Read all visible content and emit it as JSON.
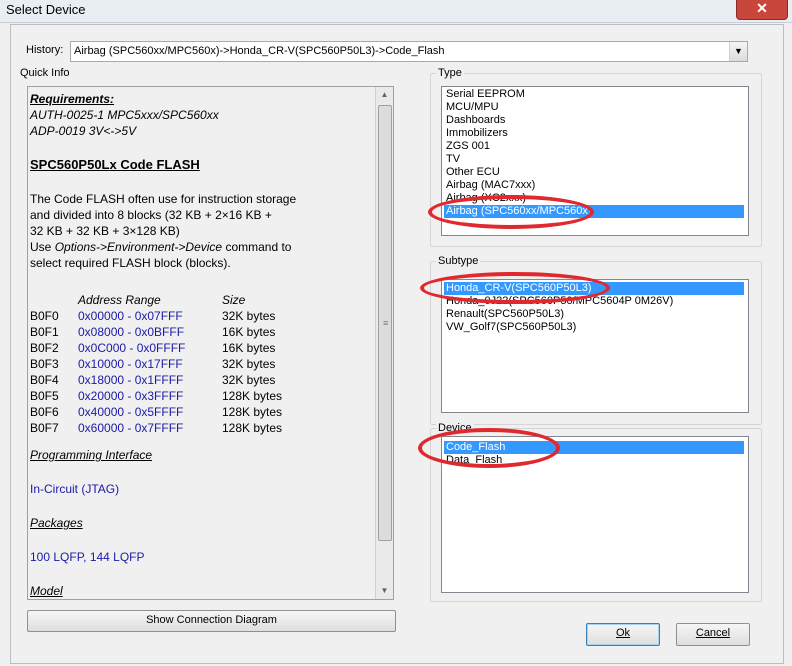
{
  "window": {
    "title": "Select Device",
    "close_glyph": "✕"
  },
  "history": {
    "label": "History:",
    "value": "Airbag (SPC560xx/MPC560x)->Honda_CR-V(SPC560P50L3)->Code_Flash",
    "arrow_glyph": "▼"
  },
  "quick_info": {
    "label": "Quick Info",
    "requirements_heading": "Requirements:",
    "requirement_1": "AUTH-0025-1 MPC5xxx/SPC560xx",
    "requirement_2": "ADP-0019 3V<->5V",
    "device_title": "SPC560P50Lx Code FLASH",
    "desc_line_1": "The Code FLASH often use for instruction storage",
    "desc_line_2": "and divided into 8 blocks (32 KB + 2×16 KB +",
    "desc_line_3": "32 KB + 32 KB + 3×128 KB)",
    "desc_line_4_prefix": "Use ",
    "desc_line_4_italic": "Options->Environment->Device",
    "desc_line_4_suffix": " command to",
    "desc_line_5": "select required FLASH block (blocks).",
    "table_header_range": "Address Range",
    "table_header_size": "Size",
    "blocks": [
      {
        "name": "B0F0",
        "range": "0x00000 - 0x07FFF",
        "size": "32K bytes"
      },
      {
        "name": "B0F1",
        "range": "0x08000 - 0x0BFFF",
        "size": "16K bytes"
      },
      {
        "name": "B0F2",
        "range": "0x0C000 - 0x0FFFF",
        "size": "16K bytes"
      },
      {
        "name": "B0F3",
        "range": "0x10000 - 0x17FFF",
        "size": "32K bytes"
      },
      {
        "name": "B0F4",
        "range": "0x18000 - 0x1FFFF",
        "size": "32K bytes"
      },
      {
        "name": "B0F5",
        "range": "0x20000 - 0x3FFFF",
        "size": "128K bytes"
      },
      {
        "name": "B0F6",
        "range": "0x40000 - 0x5FFFF",
        "size": "128K bytes"
      },
      {
        "name": "B0F7",
        "range": "0x60000 - 0x7FFFF",
        "size": "128K bytes"
      }
    ],
    "programming_interface_heading": "Programming Interface",
    "programming_interface_value": "In-Circuit (JTAG)",
    "packages_heading": "Packages",
    "packages_value": "100 LQFP, 144 LQFP",
    "model_heading": "Model",
    "scroll_up_glyph": "▲",
    "scroll_down_glyph": "▼",
    "scroll_grip_glyph": "≡"
  },
  "show_connection_button": "Show Connection Diagram",
  "type_group": {
    "label": "Type",
    "items": [
      "Serial EEPROM",
      "MCU/MPU",
      "Dashboards",
      "Immobilizers",
      "ZGS 001",
      "TV",
      "Other ECU",
      "Airbag (MAC7xxx)",
      "Airbag (XC2xxx)",
      "Airbag (SPC560xx/MPC560x)"
    ],
    "selected_index": 9
  },
  "subtype_group": {
    "label": "Subtype",
    "items": [
      "Honda_CR-V(SPC560P50L3)",
      "Honda_0J22(SPC560P50/MPC5604P 0M26V)",
      "Renault(SPC560P50L3)",
      "VW_Golf7(SPC560P50L3)"
    ],
    "selected_index": 0
  },
  "device_group": {
    "label": "Device",
    "items": [
      "Code_Flash",
      "Data_Flash"
    ],
    "selected_index": 0
  },
  "ok_button": "Ok",
  "cancel_button": "Cancel",
  "annotation_color": "#e0282f",
  "selection_color": "#3399ff"
}
